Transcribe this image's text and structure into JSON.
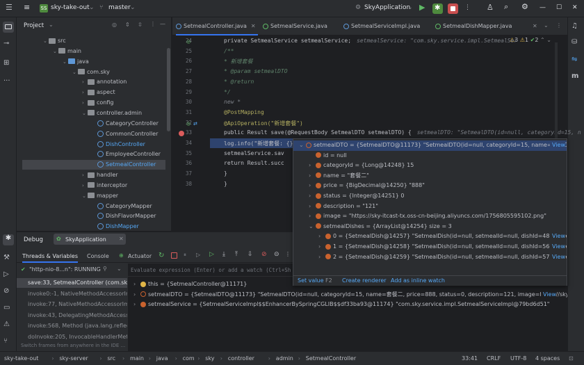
{
  "titlebar": {
    "project_badge": "SS",
    "project_name": "sky-take-out",
    "branch": "master",
    "run_config": "SkyApplication"
  },
  "project_panel": {
    "title": "Project",
    "tree": [
      {
        "label": "src",
        "kind": "folder"
      },
      {
        "label": "main",
        "kind": "folder"
      },
      {
        "label": "java",
        "kind": "folder-blue"
      },
      {
        "label": "com.sky",
        "kind": "folder"
      },
      {
        "label": "annotation",
        "kind": "folder"
      },
      {
        "label": "aspect",
        "kind": "folder"
      },
      {
        "label": "config",
        "kind": "folder"
      },
      {
        "label": "controller.admin",
        "kind": "folder"
      },
      {
        "label": "CategoryController",
        "kind": "class"
      },
      {
        "label": "CommonController",
        "kind": "class"
      },
      {
        "label": "DishController",
        "kind": "class"
      },
      {
        "label": "EmployeeController",
        "kind": "class"
      },
      {
        "label": "SetmealController",
        "kind": "class"
      },
      {
        "label": "handler",
        "kind": "folder"
      },
      {
        "label": "interceptor",
        "kind": "folder"
      },
      {
        "label": "mapper",
        "kind": "folder"
      },
      {
        "label": "CategoryMapper",
        "kind": "class"
      },
      {
        "label": "DishFlavorMapper",
        "kind": "class"
      },
      {
        "label": "DishMapper",
        "kind": "class"
      }
    ]
  },
  "tabs": [
    "SetmealController.java",
    "SetmealService.java",
    "SetmealServiceImpl.java",
    "SetmealDishMapper.java"
  ],
  "editor": {
    "inspection": {
      "warn": "3",
      "weak": "1",
      "typo": "2"
    },
    "line_numbers": [
      "24",
      "25",
      "26",
      "27",
      "28",
      "29",
      "30",
      "31",
      "32",
      "33",
      "34",
      "35",
      "36",
      "37",
      "38"
    ],
    "lines": [
      {
        "code": "private SetmealService setmealService;",
        "hint": "setmealService: \"com.sky.service.impl.SetmealSer"
      },
      {
        "code": "/**",
        "hint": ""
      },
      {
        "code": " * 新增套餐",
        "hint": ""
      },
      {
        "code": " * @param setmealDTO",
        "hint": ""
      },
      {
        "code": " * @return",
        "hint": ""
      },
      {
        "code": " */",
        "hint": ""
      },
      {
        "code": "new *",
        "hint": ""
      },
      {
        "code": "@PostMapping",
        "hint": ""
      },
      {
        "code": "@ApiOperation(\"新增套餐\")",
        "hint": ""
      },
      {
        "code": "public Result save(@RequestBody SetmealDTO setmealDTO) {",
        "hint": "setmealDTO: \"SetmealDTO(id=null, categoryId=15, n"
      },
      {
        "code": "    log.info(\"新增套餐: {}\", setmealDTO);",
        "hint": "setmealDTO: \"SetmealDTO(id=null, categoryId=15, name=套餐二, price"
      },
      {
        "code": "    setmealService.sav",
        "hint": ""
      },
      {
        "code": "    return Result.succ",
        "hint": ""
      },
      {
        "code": "}",
        "hint": ""
      },
      {
        "code": "}",
        "hint": ""
      }
    ]
  },
  "popup": {
    "rows": [
      {
        "text": "setmealDTO = {SetmealDTO@11173} \"SetmealDTO(id=null, categoryId=15, name=套餐二, price...",
        "view": "View"
      },
      {
        "text": "id = null",
        "view": ""
      },
      {
        "text": "categoryId = {Long@14248} 15",
        "view": ""
      },
      {
        "text": "name = \"套餐二\"",
        "view": ""
      },
      {
        "text": "price = {BigDecimal@14250} \"888\"",
        "view": ""
      },
      {
        "text": "status = {Integer@14251} 0",
        "view": ""
      },
      {
        "text": "description = \"121\"",
        "view": ""
      },
      {
        "text": "image = \"https://sky-itcast-tx.oss-cn-beijing.aliyuncs.com/1756805595102.png\"",
        "view": ""
      },
      {
        "text": "setmealDishes = {ArrayList@14254}  size = 3",
        "view": ""
      },
      {
        "text": "0 = {SetmealDish@14257} \"SetmealDish(id=null, setmealId=null, dishId=48, name=雪花啤...",
        "view": "View"
      },
      {
        "text": "1 = {SetmealDish@14258} \"SetmealDish(id=null, setmealId=null, dishId=56, name=清炒西...",
        "view": "View"
      },
      {
        "text": "2 = {SetmealDish@14259} \"SetmealDish(id=null, setmealId=null, dishId=57, name=炝炒圆...",
        "view": "View"
      }
    ],
    "actions": {
      "set_value": "Set value",
      "set_value_key": "F2",
      "create_renderer": "Create renderer",
      "add_inline": "Add as inline watch"
    }
  },
  "debug": {
    "title": "Debug",
    "session": "SkyApplication",
    "subtabs": {
      "threads": "Threads & Variables",
      "console": "Console",
      "actuator": "Actuator"
    },
    "thread": "\"http-nio-8...n\": RUNNING",
    "eval_placeholder": "Evaluate expression (Enter) or add a watch (Ctrl+Sh",
    "frames": [
      "save:33, SetmealController (com.sky.",
      "invoke0:-1, NativeMethodAccessorImpl",
      "invoke:77, NativeMethodAccessorImp",
      "invoke:43, DelegatingMethodAccessor",
      "invoke:568, Method (java.lang.reflect",
      "doInvoke:205, InvocableHandlerMeth"
    ],
    "frames_hint": "Switch frames from anywhere in the IDE ...",
    "vars": [
      {
        "text": "this = {SetmealController@11171}",
        "view": ""
      },
      {
        "text": "setmealDTO = {SetmealDTO@11173} \"SetmealDTO(id=null, categoryId=15, name=套餐二, price=888, status=0, description=121, image=https://sky-itc...",
        "view": "View"
      },
      {
        "text": "setmealService = {SetmealServiceImpl$$EnhancerBySpringCGLIB$$df33ba93@11174} \"com.sky.service.impl.SetmealServiceImpl@79bd6d51\"",
        "view": ""
      }
    ]
  },
  "status": {
    "crumbs": [
      "sky-take-out",
      "sky-server",
      "src",
      "main",
      "java",
      "com",
      "sky",
      "controller",
      "admin",
      "SetmealController"
    ],
    "position": "33:41",
    "line_sep": "CRLF",
    "encoding": "UTF-8",
    "indent": "4 spaces"
  }
}
